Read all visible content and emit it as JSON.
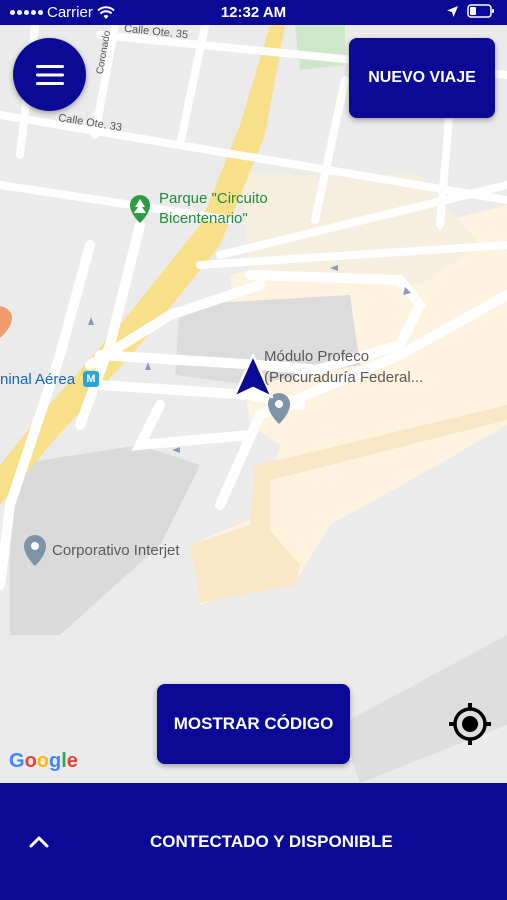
{
  "status_bar": {
    "carrier": "Carrier",
    "time": "12:32 AM"
  },
  "map": {
    "labels": {
      "parque_line1": "Parque \"Circuito",
      "parque_line2": "Bicentenario\"",
      "modulo_line1": "Módulo Profeco",
      "modulo_line2": "(Procuraduría Federal...",
      "corporativo": "Corporativo Interjet",
      "terminal": "ninal Aérea",
      "metro": "M",
      "calle_ote_35": "Calle Ote. 35",
      "calle_ote_33": "Calle Ote. 33",
      "coronado": "Coronado"
    },
    "google": "Google"
  },
  "buttons": {
    "nuevo_viaje": "NUEVO VIAJE",
    "mostrar_codigo": "MOSTRAR CÓDIGO"
  },
  "bottom_bar": {
    "status": "CONTECTADO Y DISPONIBLE"
  },
  "colors": {
    "brand": "#0a0a96",
    "map_bg": "#ebebeb",
    "road": "#ffffff",
    "highway": "#f8e08a",
    "campus": "#fdf3de",
    "green_pin": "#2e9b45",
    "gray_pin": "#7c93a8"
  },
  "icons": {
    "menu": "hamburger-icon",
    "wifi": "wifi-icon",
    "location_arrow": "location-arrow-icon",
    "battery": "battery-icon",
    "navigation": "navigation-arrow-icon",
    "locate": "crosshair-icon",
    "expand": "chevron-up-icon",
    "tree_pin": "park-pin-icon",
    "place_pin": "place-pin-icon"
  }
}
